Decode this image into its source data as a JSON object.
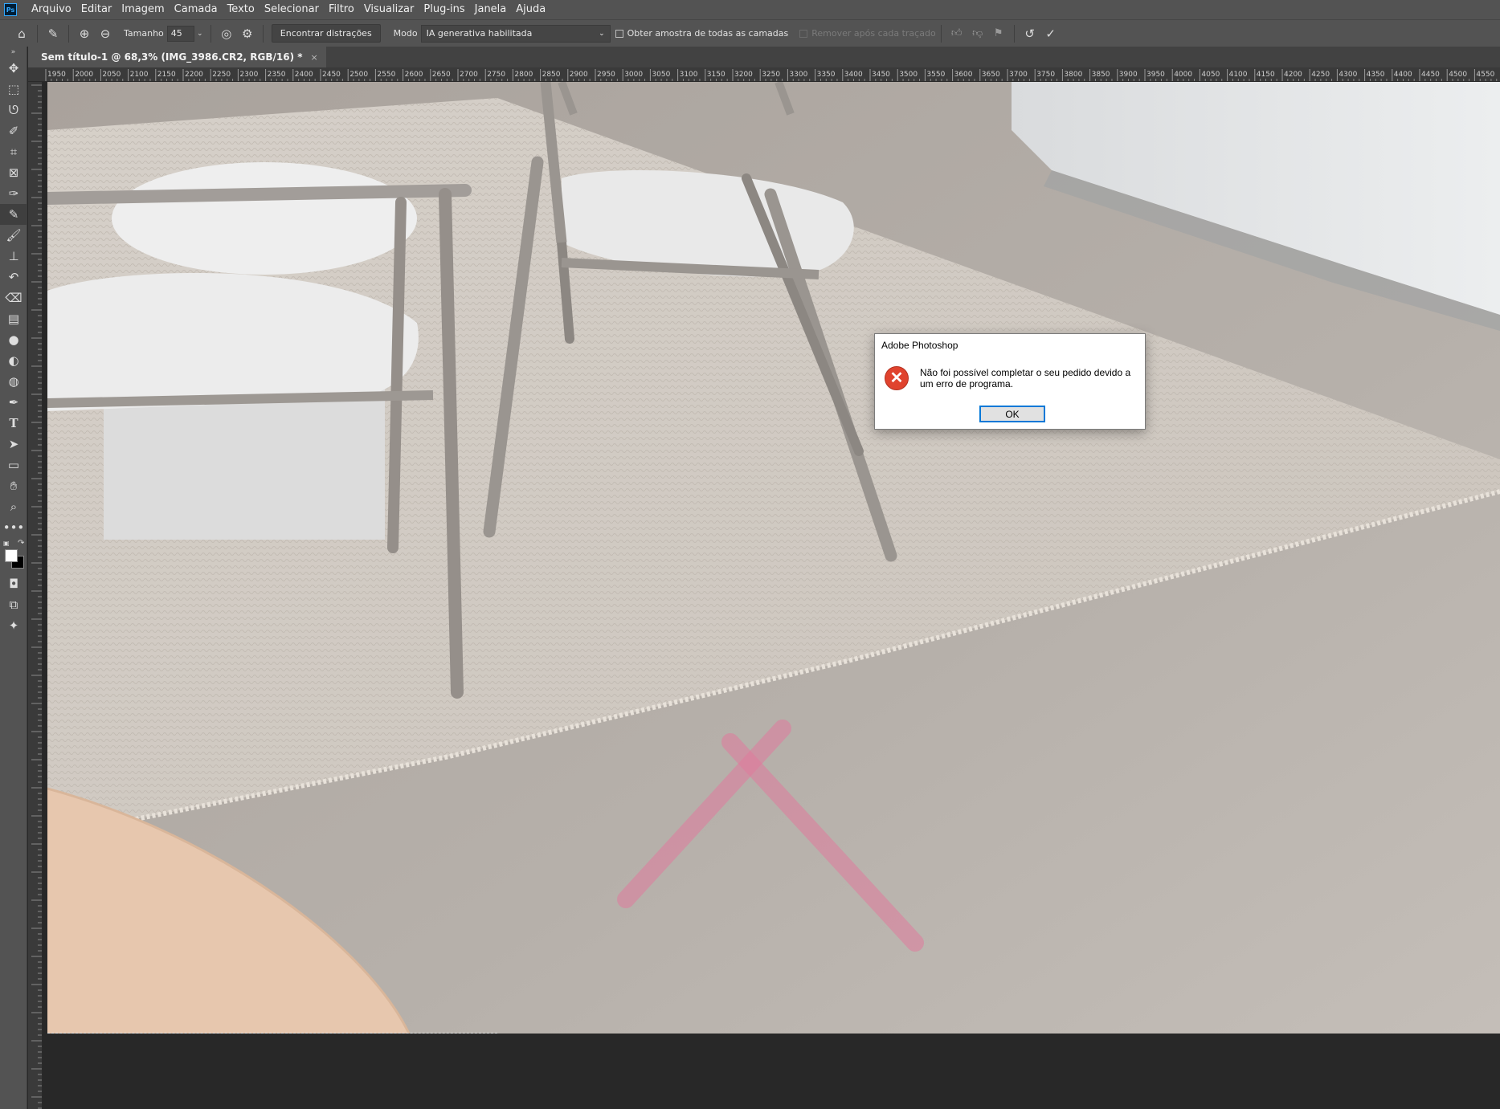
{
  "app": {
    "logo": "Ps"
  },
  "menu": [
    "Arquivo",
    "Editar",
    "Imagem",
    "Camada",
    "Texto",
    "Selecionar",
    "Filtro",
    "Visualizar",
    "Plug-ins",
    "Janela",
    "Ajuda"
  ],
  "options": {
    "size_label": "Tamanho",
    "size_value": "45",
    "find_distractions_label": "Encontrar distrações",
    "mode_label": "Modo",
    "mode_value": "IA generativa habilitada",
    "sample_all_layers_label": "Obter amostra de todas as camadas",
    "sample_all_layers_checked": false,
    "remove_after_stroke_label": "Remover após cada traçado",
    "remove_after_stroke_checked": false
  },
  "tools": [
    "move-tool",
    "marquee-tool",
    "lasso-tool",
    "quick-selection-tool",
    "crop-tool",
    "frame-tool",
    "eyedropper-tool",
    "remove-tool",
    "brush-tool",
    "stamp-tool",
    "history-brush-tool",
    "eraser-tool",
    "gradient-tool",
    "blur-tool",
    "dodge-tool",
    "sponge-tool",
    "pen-tool",
    "type-tool",
    "path-selection-tool",
    "rectangle-tool",
    "hand-tool",
    "zoom-tool",
    "more-tools"
  ],
  "colors": {
    "foreground": "#ffffff",
    "background": "#000000",
    "accent": "#0078d7",
    "error": "#e0432e",
    "stroke": "#e07a9c"
  },
  "document": {
    "tab_title": "Sem título-1 @ 68,3% (IMG_3986.CR2, RGB/16) *",
    "close_glyph": "×"
  },
  "ruler": {
    "top_labels": [
      "1950",
      "2000",
      "2050",
      "2100",
      "2150",
      "2200",
      "2250",
      "2300",
      "2350",
      "2400",
      "2450",
      "2500",
      "2550",
      "2600",
      "2650",
      "2700",
      "2750",
      "2800",
      "2850",
      "2900",
      "2950",
      "3000",
      "3050",
      "3100",
      "3150",
      "3200",
      "3250",
      "3300",
      "3350",
      "3400",
      "3450",
      "3500",
      "3550",
      "3600",
      "3650",
      "3700",
      "3750",
      "3800",
      "3850",
      "3900",
      "3950",
      "4000",
      "4050",
      "4100",
      "4150",
      "4200",
      "4250",
      "4300",
      "4350",
      "4400",
      "4450",
      "4500",
      "4550"
    ]
  },
  "dialog": {
    "title": "Adobe Photoshop",
    "message": "Não foi possível completar o seu pedido devido a um erro de programa.",
    "ok_label": "OK",
    "icon": "error-icon"
  }
}
